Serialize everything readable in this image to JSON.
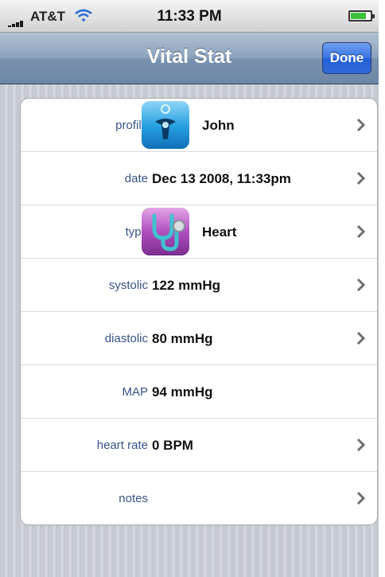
{
  "status_bar": {
    "carrier": "AT&T",
    "time": "11:33 PM"
  },
  "nav": {
    "title": "Vital Stat",
    "done_label": "Done"
  },
  "rows": [
    {
      "label": "profile",
      "value": "John",
      "icon": "profile-person-icon",
      "disclosure": true
    },
    {
      "label": "date",
      "value": "Dec 13 2008, 11:33pm",
      "disclosure": true
    },
    {
      "label": "type",
      "value": "Heart",
      "icon": "stethoscope-icon",
      "disclosure": true
    },
    {
      "label": "systolic",
      "value": "122 mmHg",
      "disclosure": true
    },
    {
      "label": "diastolic",
      "value": "80 mmHg",
      "disclosure": true
    },
    {
      "label": "MAP",
      "value": "94 mmHg",
      "disclosure": false
    },
    {
      "label": "heart rate",
      "value": "0 BPM",
      "disclosure": true
    },
    {
      "label": "notes",
      "value": "",
      "disclosure": true
    }
  ],
  "colors": {
    "label_blue": "#385487",
    "nav_blue": "#7a92ae",
    "done_blue": "#2f6ad9"
  }
}
